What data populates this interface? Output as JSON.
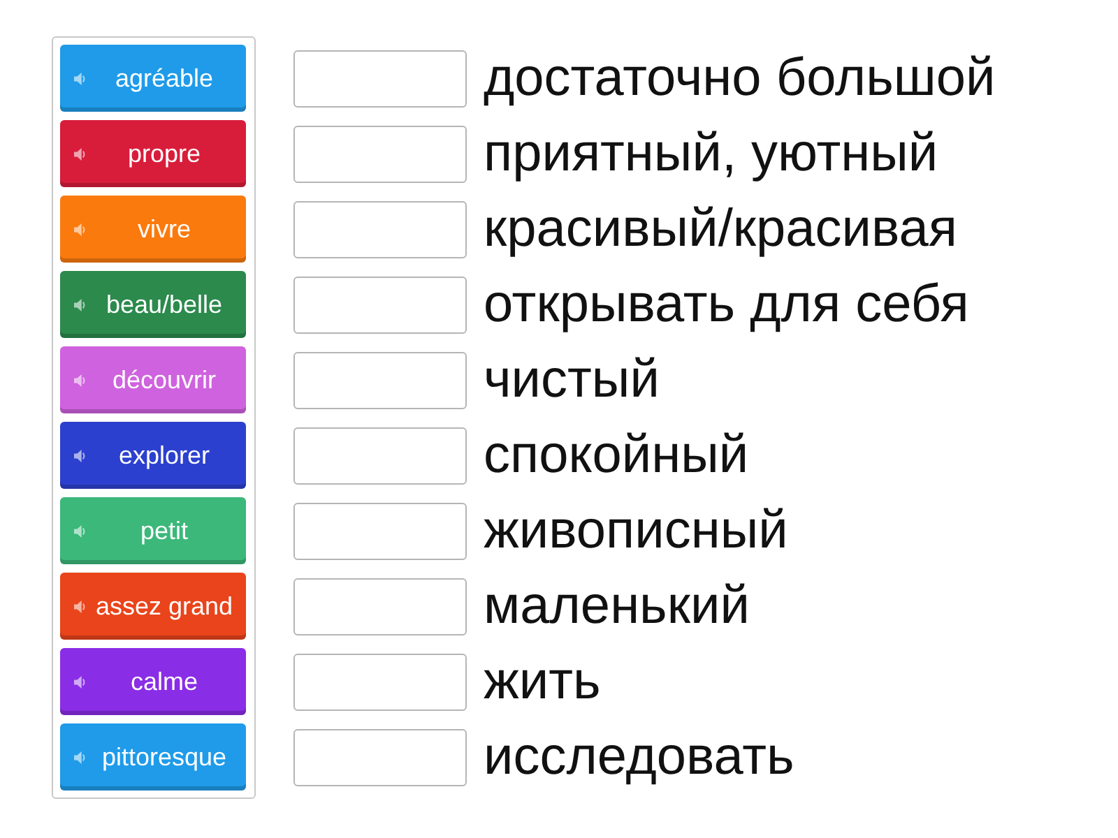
{
  "tiles": [
    {
      "label": "agréable",
      "color": "#1f9be9"
    },
    {
      "label": "propre",
      "color": "#d81d3b"
    },
    {
      "label": "vivre",
      "color": "#fb7a0e"
    },
    {
      "label": "beau/belle",
      "color": "#2b8a4c"
    },
    {
      "label": "découvrir",
      "color": "#cf62de"
    },
    {
      "label": "explorer",
      "color": "#2c40cf"
    },
    {
      "label": "petit",
      "color": "#3bb87a"
    },
    {
      "label": "assez grand",
      "color": "#e9441b"
    },
    {
      "label": "calme",
      "color": "#8a2de6"
    },
    {
      "label": "pittoresque",
      "color": "#1f9be9"
    }
  ],
  "targets": [
    {
      "text": "достаточно большой"
    },
    {
      "text": "приятный, уютный"
    },
    {
      "text": "красивый/красивая"
    },
    {
      "text": "открывать для себя"
    },
    {
      "text": "чистый"
    },
    {
      "text": "спокойный"
    },
    {
      "text": "живописный"
    },
    {
      "text": "маленький"
    },
    {
      "text": "жить"
    },
    {
      "text": "исследовать"
    }
  ]
}
